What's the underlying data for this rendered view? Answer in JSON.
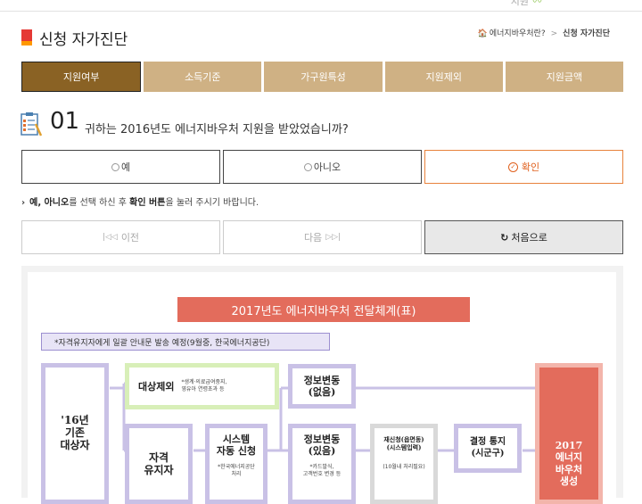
{
  "header": {
    "logo_partial": "지원",
    "title": "신청 자가진단",
    "breadcrumb": [
      "에너지바우처란?",
      "신청 자가진단"
    ]
  },
  "tabs": [
    "지원여부",
    "소득기준",
    "가구원특성",
    "지원제외",
    "지원금액"
  ],
  "question": {
    "number": "01",
    "text": "귀하는 2016년도 에너지바우처 지원을 받았었습니까?"
  },
  "answers": {
    "yes": "예",
    "no": "아니오",
    "confirm": "확인"
  },
  "hint": {
    "part1": "예, 아니오",
    "part2": "를 선택 하신 후 ",
    "part3": "확인 버튼",
    "part4": "을 눌러 주시기 바랍니다."
  },
  "navigation": {
    "prev": "이전",
    "next": "다음",
    "reset": "처음으로"
  },
  "diagram": {
    "title": "2017년도 에너지바우처 전달체계(표)",
    "subtitle": "*자격유지자에게 일괄 안내문 발송 예정(9월중, 한국에너지공단)",
    "existing_label": "'16년\n기존\n대상자",
    "exclusion_label": "대상제외",
    "exclusion_note": "*생계·의료급여중지,\n영유아 연령초과 등",
    "qualified_label": "자격\n유지자",
    "system_label": "시스템\n자동 신청",
    "system_note": "*한국에너지공단\n처리",
    "no_change_label": "정보변동\n(없음)",
    "change_label": "정보변동\n(있음)",
    "change_note": "*카드발식,\n고객번호 변경 등",
    "reapply_label": "재신청(읍면동)\n(시스템입력)",
    "reapply_note": "(10월내 처리필요)",
    "decision_label": "결정 통지\n(시군구)",
    "result_label": "2017\n에너지\n바우처\n생성"
  },
  "colors": {
    "tab": "#cfb184",
    "tab_active": "#8a6224",
    "accent": "#e8823c",
    "diagram_title": "#e36c5c",
    "diagram_result": "#e36c5c",
    "box_border": "#9c8fd0",
    "box_fill": "#e8e4f6",
    "green_border": "#c8e6a0"
  }
}
